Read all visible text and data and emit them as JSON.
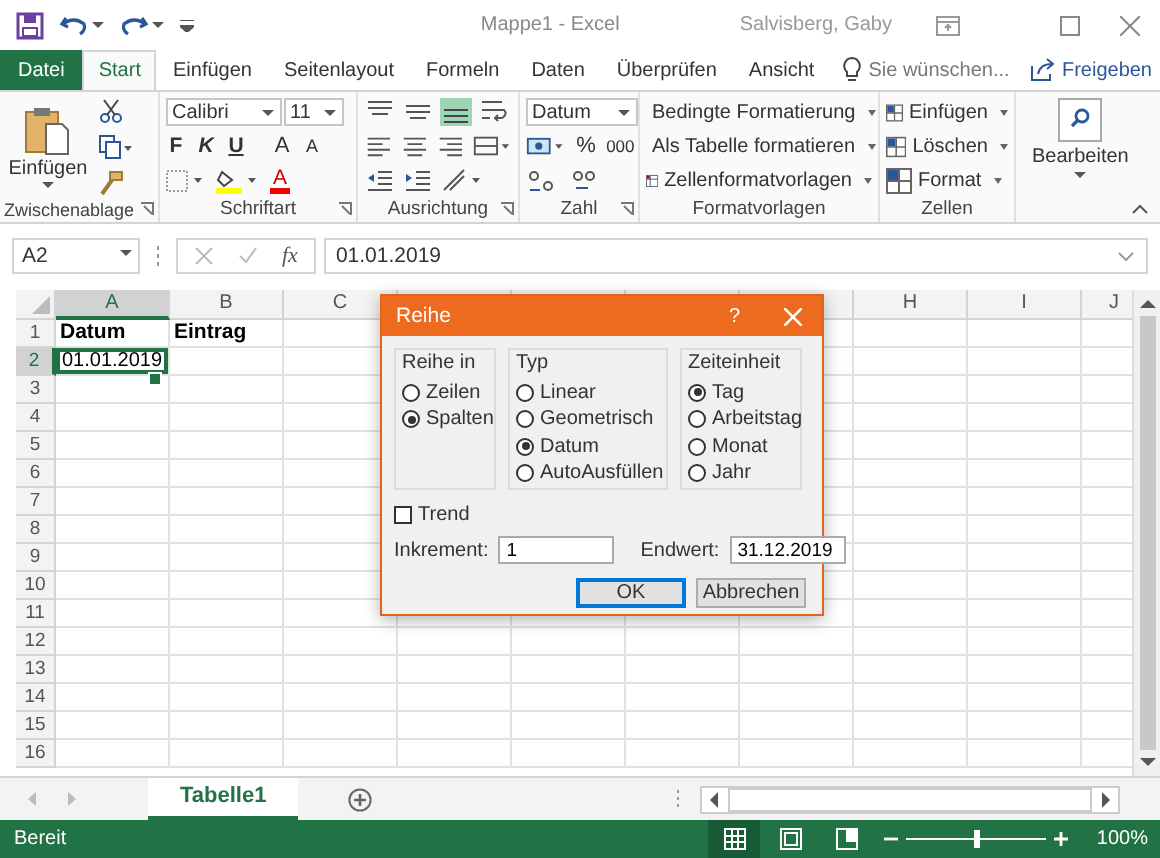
{
  "window": {
    "title": "Mappe1 - Excel",
    "user": "Salvisberg, Gaby"
  },
  "ribbon_tabs": [
    {
      "label": "Datei",
      "kind": "file",
      "selected": false
    },
    {
      "label": "Start",
      "kind": "tab",
      "selected": true
    },
    {
      "label": "Einfügen",
      "kind": "tab",
      "selected": false
    },
    {
      "label": "Seitenlayout",
      "kind": "tab",
      "selected": false
    },
    {
      "label": "Formeln",
      "kind": "tab",
      "selected": false
    },
    {
      "label": "Daten",
      "kind": "tab",
      "selected": false
    },
    {
      "label": "Überprüfen",
      "kind": "tab",
      "selected": false
    },
    {
      "label": "Ansicht",
      "kind": "tab",
      "selected": false
    }
  ],
  "tell_me": {
    "placeholder": "Sie wünschen..."
  },
  "share": "Freigeben",
  "ribbon": {
    "clipboard": {
      "label": "Zwischenablage",
      "paste": "Einfügen"
    },
    "font": {
      "label": "Schriftart",
      "font_name": "Calibri",
      "font_size": "11",
      "styles": [
        "F",
        "K",
        "U"
      ],
      "grow": "A",
      "shrink": "A",
      "font_color": "A"
    },
    "alignment": {
      "label": "Ausrichtung"
    },
    "number": {
      "label": "Zahl",
      "format": "Datum",
      "percent": "%",
      "thousands": "000"
    },
    "styles": {
      "label": "Formatvorlagen",
      "items": [
        "Bedingte Formatierung",
        "Als Tabelle formatieren",
        "Zellenformatvorlagen"
      ]
    },
    "cells": {
      "label": "Zellen",
      "items": [
        "Einfügen",
        "Löschen",
        "Format"
      ]
    },
    "editing": {
      "label": "Bearbeiten"
    }
  },
  "formula_bar": {
    "name_box": "A2",
    "function_label": "fx",
    "value": "01.01.2019"
  },
  "grid": {
    "columns": [
      {
        "label": "A",
        "selected": true
      },
      {
        "label": "B",
        "selected": false
      },
      {
        "label": "C",
        "selected": false
      },
      {
        "selected": false
      },
      {
        "selected": false
      },
      {
        "selected": false
      },
      {
        "selected": false
      },
      {
        "label": "H",
        "selected": false
      },
      {
        "label": "I",
        "selected": false
      },
      {
        "label": "J",
        "selected": false
      }
    ],
    "rows": [
      {
        "label": "1",
        "selected": false,
        "cells": [
          {
            "text": "Datum",
            "kind": "text",
            "bold": true,
            "selected": false
          },
          {
            "text": "Eintrag",
            "kind": "text",
            "bold": true,
            "selected": false
          }
        ]
      },
      {
        "label": "2",
        "selected": true,
        "cells": [
          {
            "text": "01.01.2019",
            "kind": "date",
            "bold": false,
            "selected": true
          }
        ]
      },
      {
        "label": "3",
        "selected": false
      },
      {
        "label": "4",
        "selected": false
      },
      {
        "label": "5",
        "selected": false
      },
      {
        "label": "6",
        "selected": false
      },
      {
        "label": "7",
        "selected": false
      },
      {
        "label": "8",
        "selected": false
      },
      {
        "label": "9",
        "selected": false
      },
      {
        "label": "10",
        "selected": false
      },
      {
        "label": "11",
        "selected": false
      },
      {
        "label": "12",
        "selected": false
      },
      {
        "label": "13",
        "selected": false
      },
      {
        "label": "14",
        "selected": false
      },
      {
        "label": "15",
        "selected": false
      },
      {
        "label": "16",
        "selected": false
      }
    ]
  },
  "dialog": {
    "title": "Reihe",
    "help": "?",
    "groups": [
      {
        "title": "Reihe in",
        "options": [
          {
            "label": "Zeilen",
            "selected": false
          },
          {
            "label": "Spalten",
            "selected": true
          }
        ]
      },
      {
        "title": "Typ",
        "options": [
          {
            "label": "Linear",
            "selected": false
          },
          {
            "label": "Geometrisch",
            "selected": false
          },
          {
            "label": "Datum",
            "selected": true
          },
          {
            "label": "AutoAusfüllen",
            "selected": false
          }
        ]
      },
      {
        "title": "Zeiteinheit",
        "options": [
          {
            "label": "Tag",
            "selected": true
          },
          {
            "label": "Arbeitstag",
            "selected": false
          },
          {
            "label": "Monat",
            "selected": false
          },
          {
            "label": "Jahr",
            "selected": false
          }
        ]
      }
    ],
    "trend": {
      "label": "Trend",
      "checked": false
    },
    "increment": {
      "label": "Inkrement:",
      "value": "1"
    },
    "end_value": {
      "label": "Endwert:",
      "value": "31.12.2019"
    },
    "buttons": [
      {
        "label": "OK",
        "default": true
      },
      {
        "label": "Abbrechen",
        "default": false
      }
    ]
  },
  "sheet_tabs": [
    {
      "label": "Tabelle1",
      "selected": true
    }
  ],
  "status_bar": {
    "status": "Bereit",
    "zoom": "100%",
    "level": 0.5
  }
}
